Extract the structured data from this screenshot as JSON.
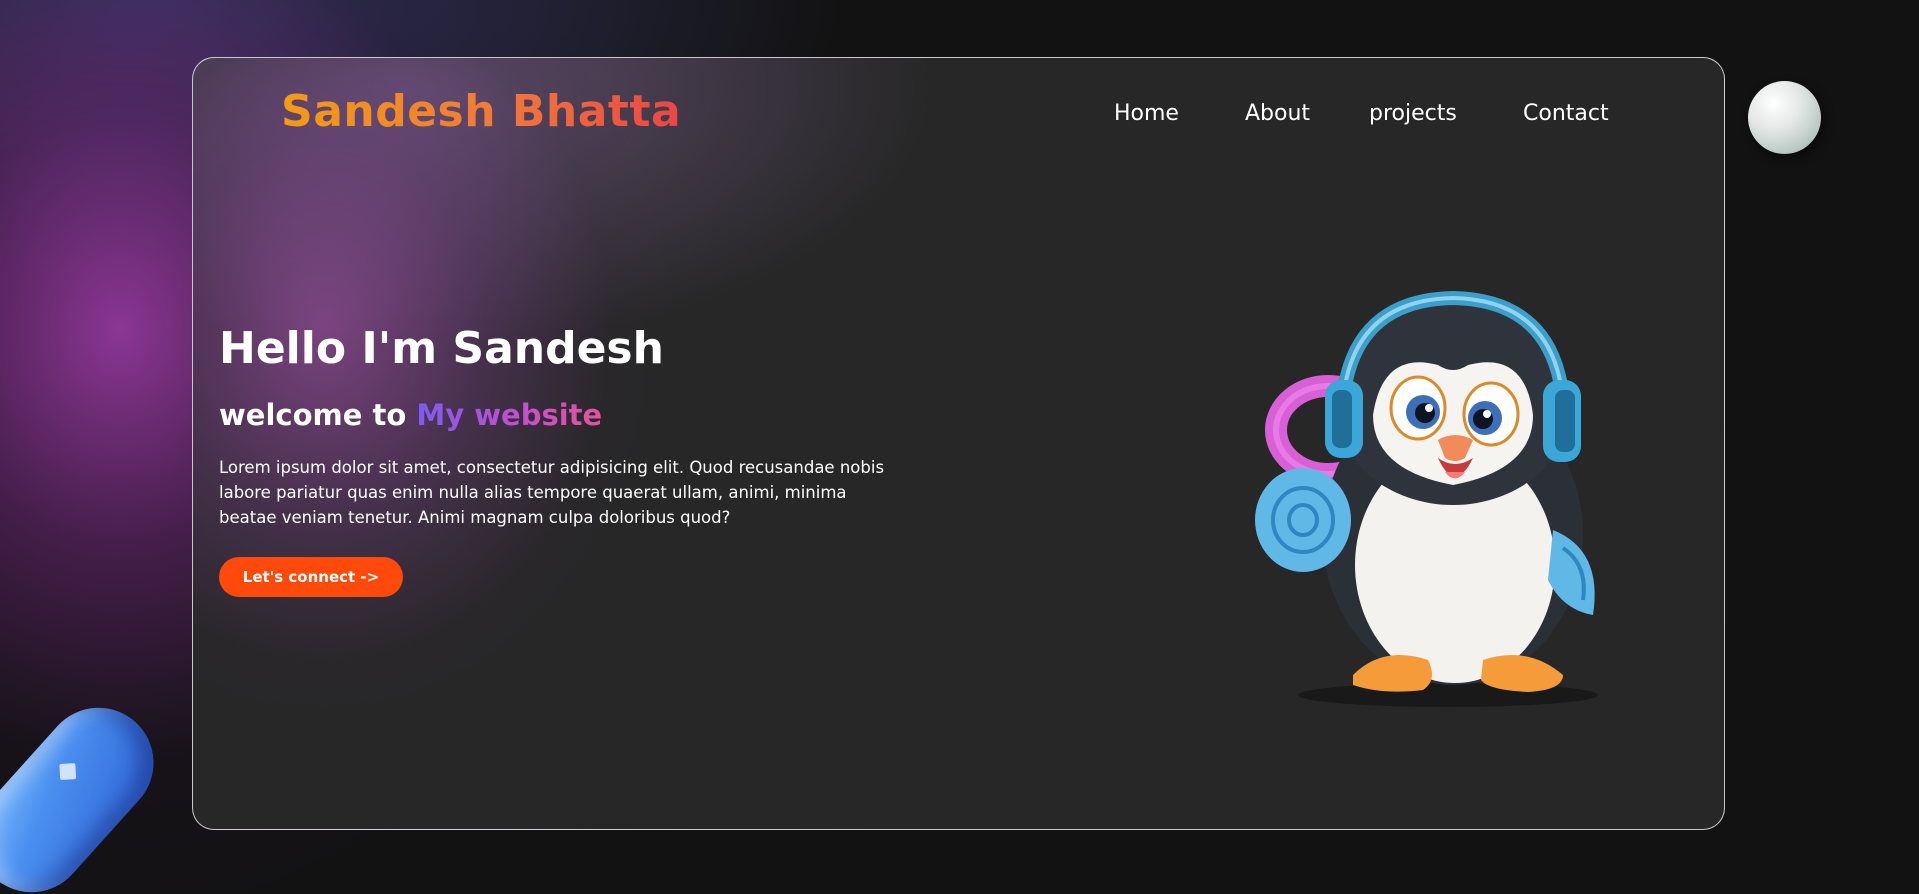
{
  "brand": {
    "name": "Sandesh Bhatta"
  },
  "nav": {
    "items": [
      {
        "label": "Home"
      },
      {
        "label": "About"
      },
      {
        "label": "projects"
      },
      {
        "label": "Contact"
      }
    ]
  },
  "hero": {
    "title": "Hello I'm Sandesh",
    "subtitle_prefix": "welcome to ",
    "subtitle_accent": "My website",
    "description": "Lorem ipsum dolor sit amet, consectetur adipisicing elit. Quod recusandae nobis labore pariatur quas enim nulla alias tempore quaerat ullam, animi, minima beatae veniam tenetur. Animi magnam culpa doloribus quod?",
    "cta_label": "Let's connect ->"
  },
  "illustration": {
    "icon": "penguin-with-headphones-icon"
  },
  "colors": {
    "brand_gradient_start": "#f39c12",
    "brand_gradient_end": "#ec4545",
    "accent_gradient_start": "#7b5cf0",
    "accent_gradient_end": "#e0559a",
    "cta_background": "#ff4a0b",
    "card_background": "#272727",
    "page_background": "#121212"
  }
}
